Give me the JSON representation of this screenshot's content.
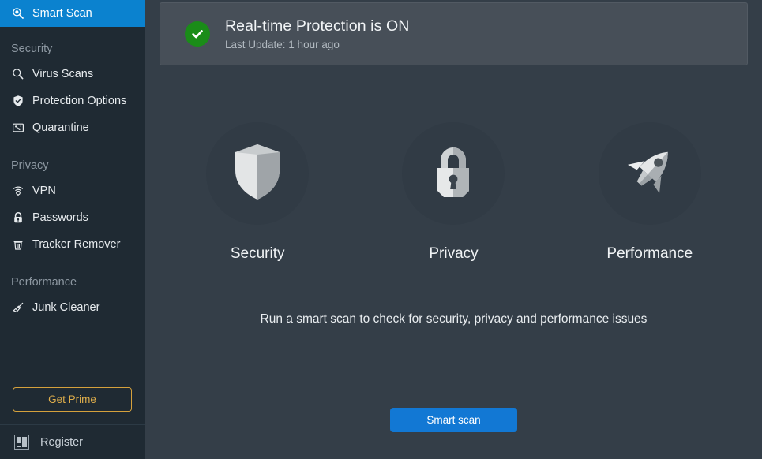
{
  "sidebar": {
    "items": [
      {
        "label": "Smart Scan",
        "icon": "smart-scan-icon",
        "active": true
      },
      {
        "label": "Security",
        "type": "group"
      },
      {
        "label": "Virus Scans",
        "icon": "magnifier-icon"
      },
      {
        "label": "Protection Options",
        "icon": "shield-check-icon"
      },
      {
        "label": "Quarantine",
        "icon": "quarantine-box-icon"
      },
      {
        "label": "Privacy",
        "type": "group"
      },
      {
        "label": "VPN",
        "icon": "vpn-signal-icon"
      },
      {
        "label": "Passwords",
        "icon": "lock-icon"
      },
      {
        "label": "Tracker Remover",
        "icon": "trash-icon"
      },
      {
        "label": "Performance",
        "type": "group"
      },
      {
        "label": "Junk Cleaner",
        "icon": "broom-icon"
      }
    ],
    "prime_button": "Get Prime",
    "register": {
      "label": "Register",
      "icon": "qr-code-icon"
    }
  },
  "banner": {
    "icon": "green-check-circle-icon",
    "title": "Real-time Protection is ON",
    "subtitle": "Last Update: 1 hour ago"
  },
  "features": [
    {
      "label": "Security",
      "icon": "shield-icon"
    },
    {
      "label": "Privacy",
      "icon": "padlock-icon"
    },
    {
      "label": "Performance",
      "icon": "rocket-icon"
    }
  ],
  "main": {
    "tagline": "Run a smart scan to check for security, privacy and performance issues",
    "scan_button": "Smart scan"
  },
  "colors": {
    "sidebar_bg": "#1f2a33",
    "main_bg": "#343e48",
    "banner_bg": "#474f58",
    "accent_blue": "#1278d4",
    "active_blue": "#0b82cf",
    "prime_gold": "#d5a13c",
    "status_green": "#1a8c18"
  }
}
